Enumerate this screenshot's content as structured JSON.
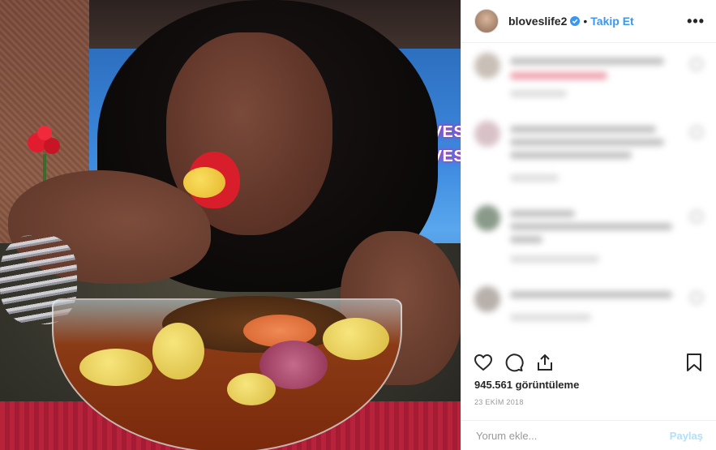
{
  "header": {
    "username": "bloveslife2",
    "separator": "•",
    "follow_label": "Takip Et",
    "more_label": "•••"
  },
  "media": {
    "overlay_text_1": "BLOVESLI",
    "overlay_text_2": "BLOVESLI"
  },
  "post": {
    "views": "945.561 görüntüleme",
    "date": "23 EKİM 2018"
  },
  "comment_box": {
    "placeholder": "Yorum ekle...",
    "post_label": "Paylaş"
  },
  "colors": {
    "link": "#3897f0",
    "post_disabled": "#b2dffc",
    "text": "#262626"
  },
  "icons": [
    "verified-badge-icon",
    "heart-icon",
    "comment-icon",
    "share-icon",
    "bookmark-icon",
    "more-options-icon"
  ]
}
